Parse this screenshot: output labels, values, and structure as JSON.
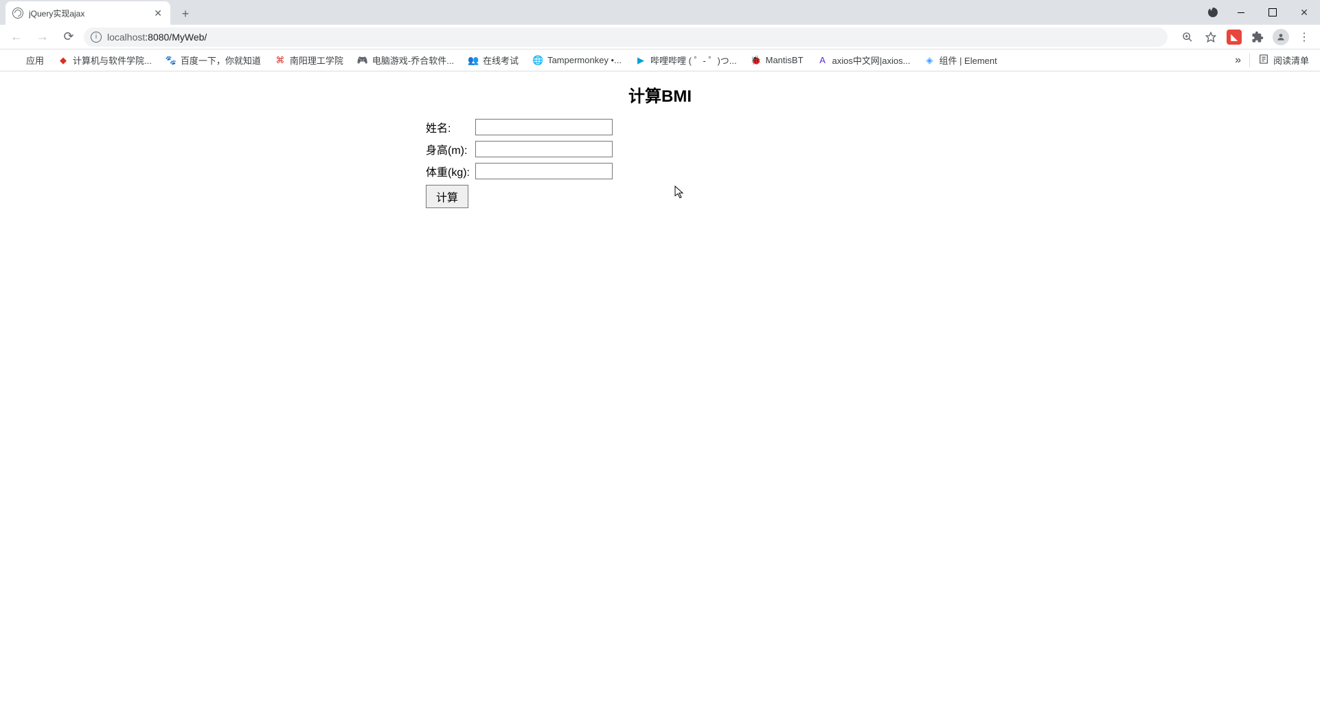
{
  "tab": {
    "title": "jQuery实现ajax"
  },
  "url": {
    "host_dim": "localhost",
    "port_path": ":8080/MyWeb/"
  },
  "bookmarks": {
    "apps": "应用",
    "items": [
      "计算机与软件学院...",
      "百度一下，你就知道",
      "南阳理工学院",
      "电脑游戏-乔合软件...",
      "在线考试",
      "Tampermonkey •...",
      "哔哩哔哩 ( ゜- ゜)つ...",
      "MantisBT",
      "axios中文网|axios...",
      "组件 | Element"
    ],
    "reading_list": "阅读清单"
  },
  "page": {
    "heading": "计算BMI",
    "labels": {
      "name": "姓名:",
      "height": "身高(m):",
      "weight": "体重(kg):"
    },
    "button": "计算"
  },
  "icons": {
    "baidu_color": "#2932e1",
    "nanyang_color": "#d93025",
    "game_color": "#1a73e8",
    "exam_color": "#1a73e8",
    "tm_color": "#5f6368",
    "bili_color": "#00a1d6",
    "mantis_color": "#a0522d",
    "axios_color": "#5a29e4",
    "element_color": "#409eff"
  }
}
